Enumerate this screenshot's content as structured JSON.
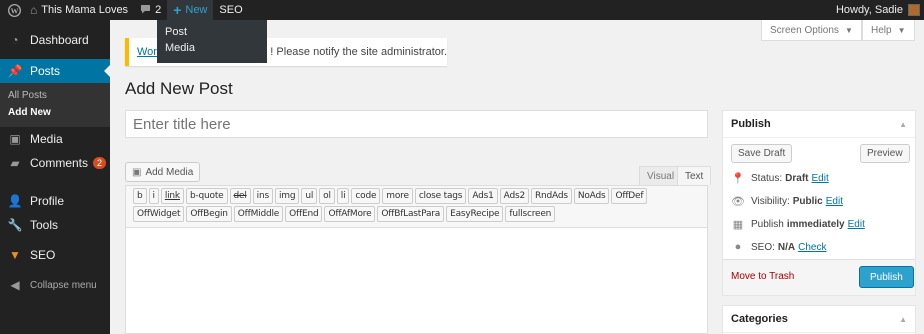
{
  "adminbar": {
    "site_name": "This Mama Loves",
    "comments_count": "2",
    "new_label": "New",
    "seo_label": "SEO",
    "howdy": "Howdy, Sadie"
  },
  "new_menu": {
    "items": [
      "Post",
      "Media"
    ]
  },
  "sidebar": {
    "dashboard": "Dashboard",
    "posts": "Posts",
    "posts_sub": [
      "All Posts",
      "Add New"
    ],
    "media": "Media",
    "comments": "Comments",
    "comments_badge": "2",
    "profile": "Profile",
    "tools": "Tools",
    "seo": "SEO",
    "collapse": "Collapse menu"
  },
  "screen_options": "Screen Options",
  "help": "Help",
  "notice": {
    "link_text": "Wor",
    "text": "! Please notify the site administrator."
  },
  "page_title": "Add New Post",
  "title_placeholder": "Enter title here",
  "editor": {
    "add_media": "Add Media",
    "tab_visual": "Visual",
    "tab_text": "Text",
    "quicktags": [
      "b",
      "i",
      "link",
      "b-quote",
      "del",
      "ins",
      "img",
      "ul",
      "ol",
      "li",
      "code",
      "more",
      "close tags",
      "Ads1",
      "Ads2",
      "RndAds",
      "NoAds",
      "OffDef",
      "OffWidget",
      "OffBegin",
      "OffMiddle",
      "OffEnd",
      "OffAfMore",
      "OffBfLastPara",
      "EasyRecipe",
      "fullscreen"
    ]
  },
  "publish": {
    "title": "Publish",
    "save_draft": "Save Draft",
    "preview": "Preview",
    "status_label": "Status:",
    "status_value": "Draft",
    "visibility_label": "Visibility:",
    "visibility_value": "Public",
    "publish_label": "Publish",
    "publish_value": "immediately",
    "seo_label": "SEO:",
    "seo_value": "N/A",
    "edit": "Edit",
    "check": "Check",
    "trash": "Move to Trash",
    "publish_button": "Publish"
  },
  "categories": {
    "title": "Categories"
  },
  "colors": {
    "accent": "#0074a2",
    "publish": "#2ea2cc",
    "adminbar": "#222222",
    "notice": "#ffba00"
  }
}
